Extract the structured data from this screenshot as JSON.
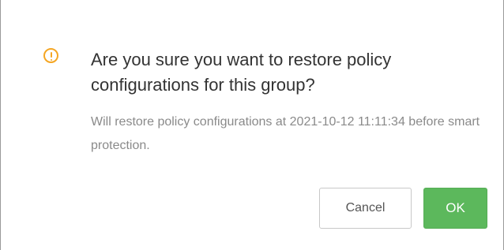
{
  "dialog": {
    "icon": "warning-circle-icon",
    "icon_color": "#f5a623",
    "title": "Are you sure you want to restore policy configurations for this group?",
    "message": "Will restore policy configurations at 2021-10-12 11:11:34 before smart protection."
  },
  "buttons": {
    "cancel_label": "Cancel",
    "ok_label": "OK",
    "ok_color": "#5cb85c"
  }
}
